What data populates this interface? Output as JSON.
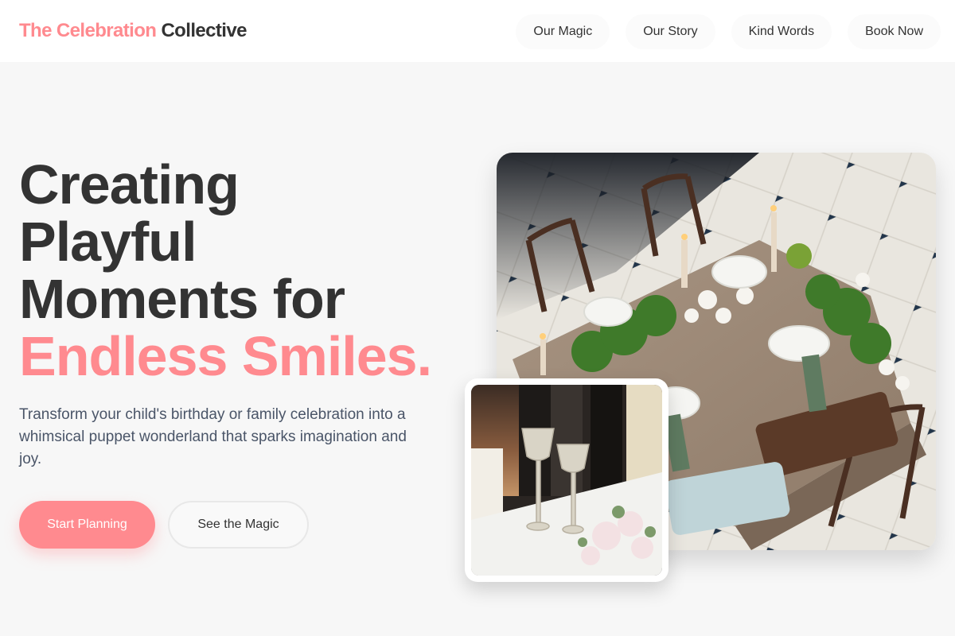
{
  "brand": {
    "name_part1": "The Celebration",
    "name_part2": "Collective"
  },
  "nav": {
    "items": [
      {
        "label": "Our Magic"
      },
      {
        "label": "Our Story"
      },
      {
        "label": "Kind Words"
      },
      {
        "label": "Book Now"
      }
    ]
  },
  "hero": {
    "title_line1": "Creating",
    "title_line2": "Playful",
    "title_line3": "Moments for",
    "title_accent": "Endless Smiles.",
    "subtitle": "Transform your child's birthday or family celebration into a whimsical puppet wonderland that sparks imagination and joy.",
    "primary_cta": "Start Planning",
    "secondary_cta": "See the Magic"
  },
  "colors": {
    "accent": "#ff8a8f",
    "text_dark": "#333333",
    "text_muted": "#4a5568",
    "background": "#f7f7f7"
  }
}
